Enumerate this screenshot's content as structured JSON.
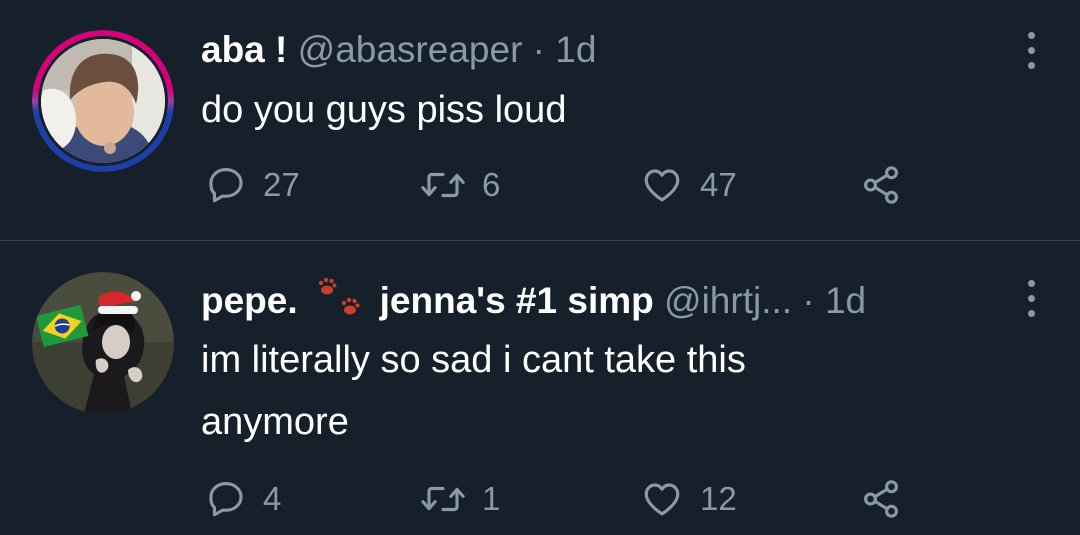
{
  "tweets": [
    {
      "display_name": "aba !",
      "handle": "@abasreaper",
      "separator": "·",
      "time": "1d",
      "text": "do you guys piss loud",
      "replies": "27",
      "retweets": "6",
      "likes": "47",
      "avatar_ring": [
        "#d6007b",
        "#9b3fa8",
        "#1f3fa8"
      ]
    },
    {
      "display_name": "pepe.",
      "display_name_emoji": "paw-prints-icon",
      "display_name_suffix": "jenna's #1 simp",
      "handle": "@ihrtj...",
      "separator": "·",
      "time": "1d",
      "text": "im literally so sad i cant take this anymore",
      "replies": "4",
      "retweets": "1",
      "likes": "12"
    }
  ],
  "colors": {
    "background": "#15202b",
    "secondary_text": "#8b98a5",
    "primary_text": "#ffffff",
    "divider": "#38444d"
  },
  "icons": [
    "reply-icon",
    "retweet-icon",
    "like-icon",
    "share-icon",
    "more-options-icon"
  ]
}
